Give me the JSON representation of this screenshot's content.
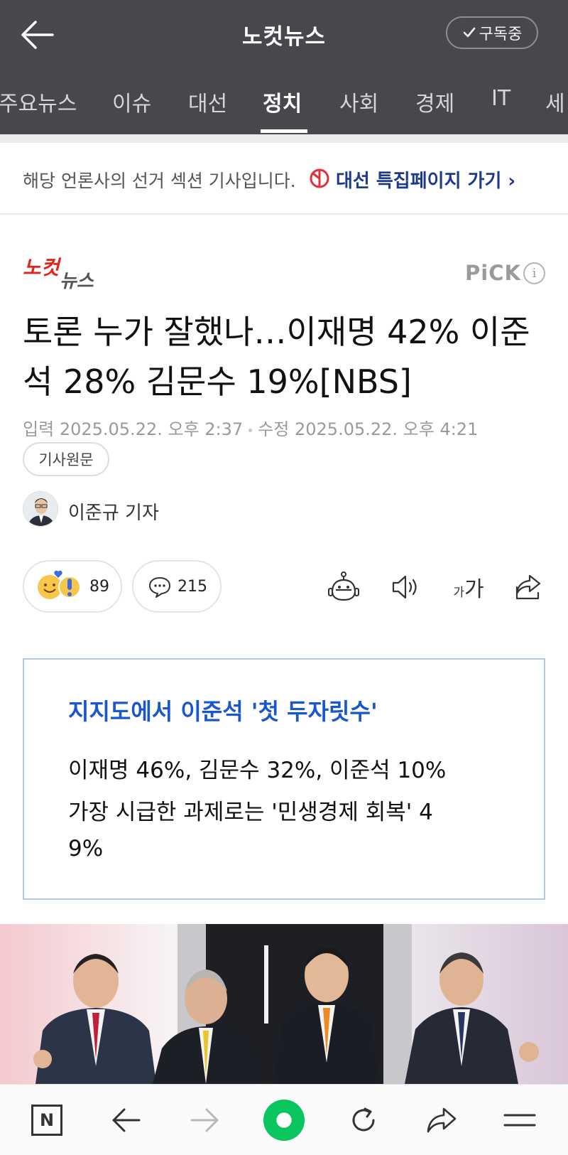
{
  "header": {
    "title": "노컷뉴스",
    "subscribe_label": "구독중"
  },
  "tabs": [
    {
      "label": "주요뉴스",
      "active": false
    },
    {
      "label": "이슈",
      "active": false
    },
    {
      "label": "대선",
      "active": false
    },
    {
      "label": "정치",
      "active": true
    },
    {
      "label": "사회",
      "active": false
    },
    {
      "label": "경제",
      "active": false
    },
    {
      "label": "IT",
      "active": false
    },
    {
      "label": "세",
      "active": false
    }
  ],
  "banner": {
    "text": "해당 언론사의 선거 섹션 기사입니다.",
    "link": "대선 특집페이지 가기 ›"
  },
  "article": {
    "press_logo": "노컷뉴스",
    "pick_label": "PiCK",
    "info_glyph": "i",
    "headline": "토론 누가 잘했나…이재명 42% 이준석 28% 김문수 19%[NBS]",
    "input_label": "입력",
    "input_date": "2025.05.22. 오후 2:37",
    "modified_label": "수정",
    "modified_date": "2025.05.22. 오후 4:21",
    "original_button": "기사원문",
    "reporter": "이준규 기자"
  },
  "actions": {
    "reaction_count": "89",
    "comment_count": "215",
    "font_small": "가",
    "font_large": "가"
  },
  "summary": {
    "title": "지지도에서 이준석 '첫 두자릿수'",
    "line1": "이재명 46%, 김문수 32%, 이준석 10%",
    "line2": "가장 시급한 과제로는 '민생경제 회복' 4",
    "line3": "9%"
  },
  "bottom_nav": {
    "n_label": "N"
  },
  "colors": {
    "header_bg": "#47474c",
    "link_blue": "#1d3a8f",
    "summary_title": "#1a57cf",
    "summary_border": "#b9c7df",
    "nav_green": "#08c55f"
  }
}
